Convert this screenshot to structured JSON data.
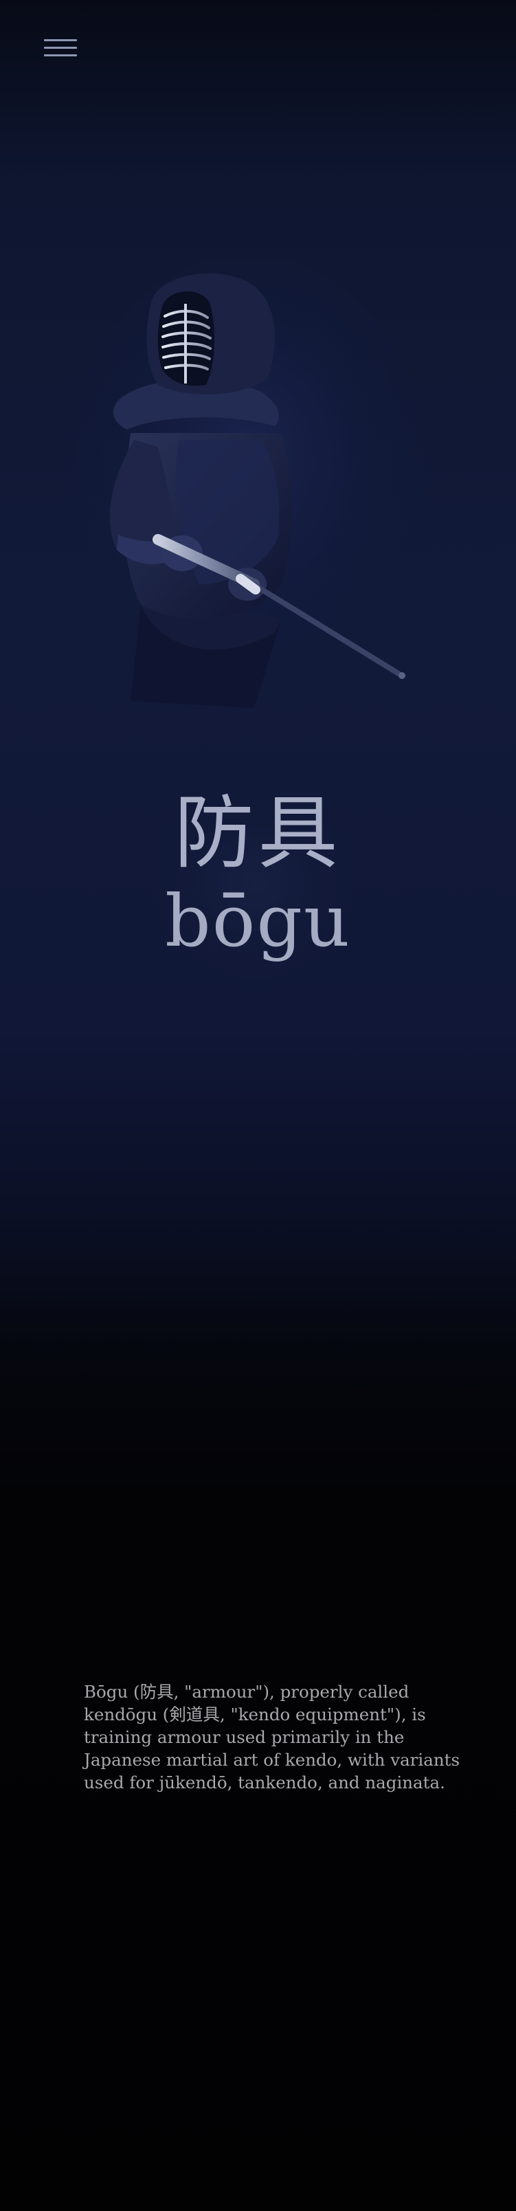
{
  "nav": {
    "menu_icon": "hamburger-menu-icon"
  },
  "hero": {
    "image_subject": "kendo practitioner in bogu armour holding shinai",
    "colors": {
      "background_top": "#0e1630",
      "background_mid": "#121a3a",
      "background_bottom": "#020203",
      "menu_icon": "#8e97b3",
      "title_text": "#a8afc6",
      "body_text": "#a9a9ad"
    }
  },
  "title": {
    "kanji": "防具",
    "romaji": "bōgu"
  },
  "description": {
    "text": "Bōgu (防具, \"armour\"), properly called kendōgu (剣道具, \"kendo equipment\"), is training armour used primarily in the Japanese martial art of kendo, with variants used for jūkendō, tankendo, and naginata."
  }
}
